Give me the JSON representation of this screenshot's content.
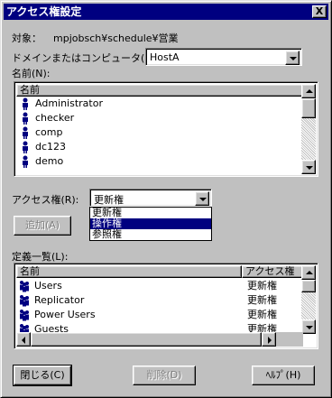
{
  "window": {
    "title": "アクセス権設定",
    "close_glyph": "X"
  },
  "target": {
    "label": "対象：",
    "value": "mpjobsch¥schedule¥営業"
  },
  "domain": {
    "label": "ドメインまたはコンピュータ(M):",
    "value": "HostA"
  },
  "names": {
    "label": "名前(N):",
    "column": "名前",
    "items": [
      "Administrator",
      "checker",
      "comp",
      "dc123",
      "demo"
    ]
  },
  "access": {
    "label": "アクセス権(R):",
    "value": "更新権",
    "options": [
      "更新権",
      "操作権",
      "参照権"
    ],
    "highlighted": "操作権"
  },
  "add_button": "追加(A)",
  "definitions": {
    "label": "定義一覧(L):",
    "columns": [
      "名前",
      "アクセス権"
    ],
    "rows": [
      {
        "name": "Users",
        "access": "更新権"
      },
      {
        "name": "Replicator",
        "access": "更新権"
      },
      {
        "name": "Power Users",
        "access": "更新権"
      },
      {
        "name": "Guests",
        "access": "更新権"
      }
    ]
  },
  "buttons": {
    "close": "閉じる(C)",
    "delete": "削除(D)",
    "help": "ﾍﾙﾌﾟ(H)"
  },
  "colors": {
    "titlebar": "#000080",
    "face": "#c0c0c0",
    "highlight": "#000080"
  }
}
